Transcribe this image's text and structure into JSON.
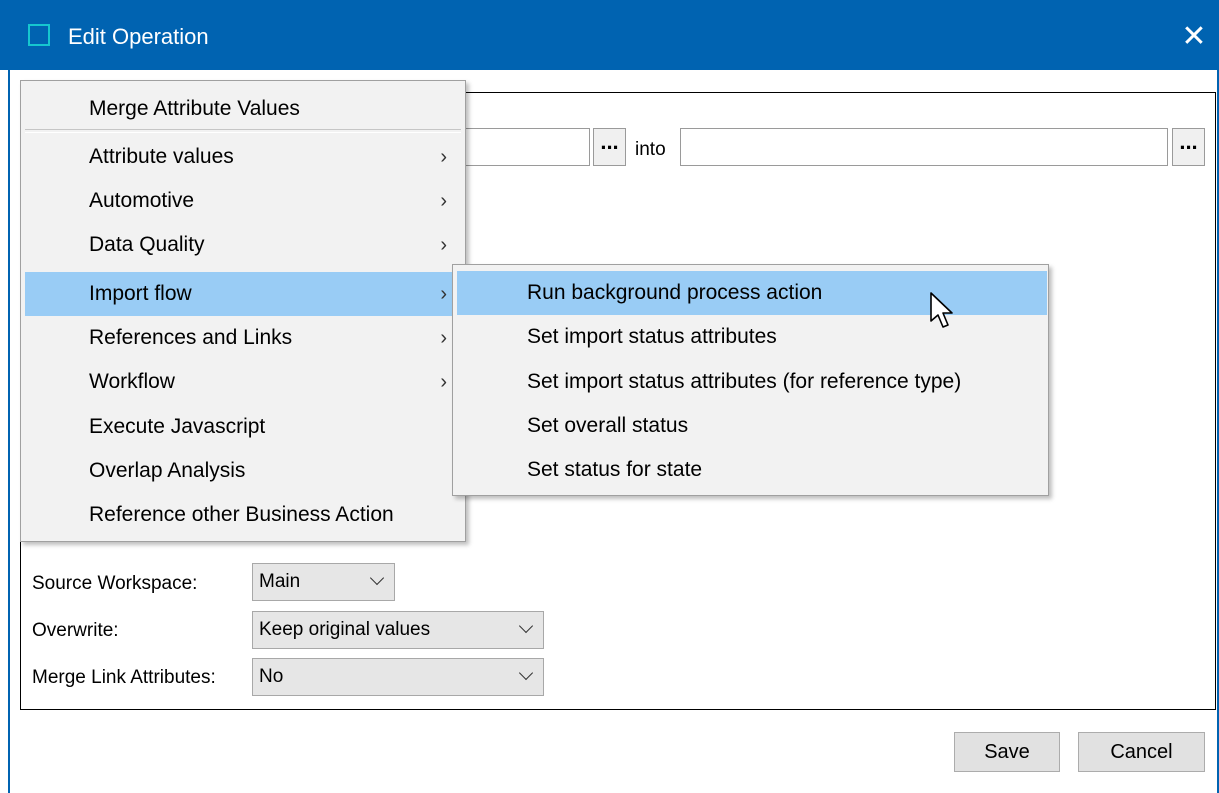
{
  "window": {
    "title": "Edit Operation",
    "close_glyph": "✕",
    "accent": "#0063b1",
    "icon": "window-icon"
  },
  "operation": {
    "into_label": "into",
    "browse_label": "..."
  },
  "form": {
    "source_workspace": {
      "label": "Source Workspace:",
      "value": "Main"
    },
    "overwrite": {
      "label": "Overwrite:",
      "value": "Keep original values"
    },
    "merge_link_attributes": {
      "label": "Merge Link Attributes:",
      "value": "No"
    }
  },
  "buttons": {
    "save": "Save",
    "cancel": "Cancel"
  },
  "menu": {
    "header": "Merge Attribute Values",
    "items": [
      {
        "label": "Attribute values",
        "submenu": true
      },
      {
        "label": "Automotive",
        "submenu": true
      },
      {
        "label": "Data Quality",
        "submenu": true
      },
      {
        "label": "Import flow",
        "submenu": true,
        "highlighted": true
      },
      {
        "label": "References and Links",
        "submenu": true
      },
      {
        "label": "Workflow",
        "submenu": true
      },
      {
        "label": "Execute Javascript",
        "submenu": false
      },
      {
        "label": "Overlap Analysis",
        "submenu": false
      },
      {
        "label": "Reference other Business Action",
        "submenu": false
      }
    ],
    "arrow_glyph": "›",
    "highlight_color": "#99ccf5"
  },
  "submenu": {
    "items": [
      {
        "label": "Run background process action",
        "highlighted": true
      },
      {
        "label": "Set import status attributes"
      },
      {
        "label": "Set import status attributes (for reference type)"
      },
      {
        "label": "Set overall status"
      },
      {
        "label": "Set status for state"
      }
    ]
  }
}
